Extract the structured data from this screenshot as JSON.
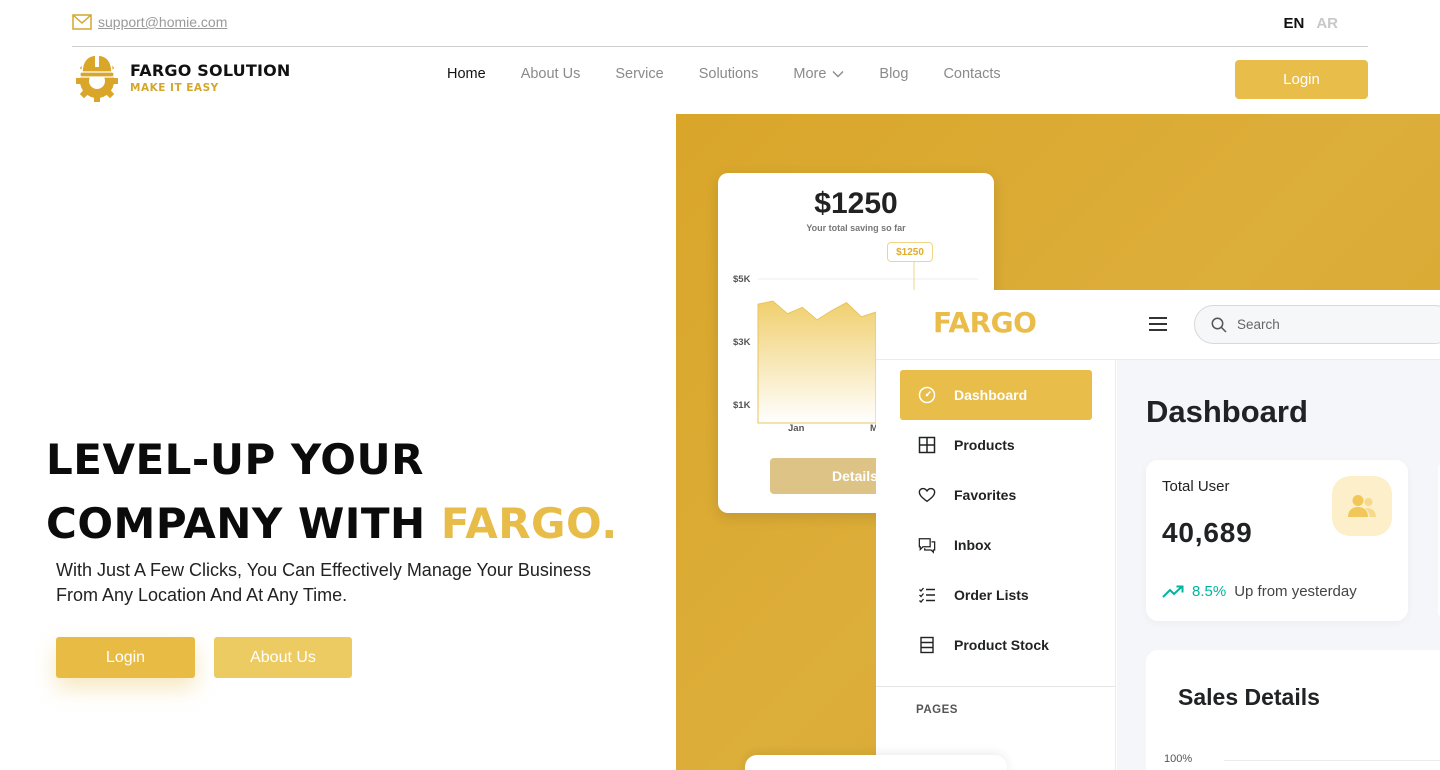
{
  "topbar": {
    "email": "support@homie.com",
    "lang_en": "EN",
    "lang_ar": "AR"
  },
  "brand": {
    "name": "FARGO SOLUTION",
    "tagline": "MAKE IT EASY",
    "logo_icon": "helmet-gear-icon",
    "accent_color": "#E9BD4A"
  },
  "nav": {
    "items": [
      {
        "label": "Home",
        "active": true
      },
      {
        "label": "About Us",
        "active": false
      },
      {
        "label": "Service",
        "active": false
      },
      {
        "label": "Solutions",
        "active": false
      },
      {
        "label": "More",
        "active": false,
        "has_dropdown": true
      },
      {
        "label": "Blog",
        "active": false
      },
      {
        "label": "Contacts",
        "active": false
      }
    ],
    "login_label": "Login"
  },
  "hero": {
    "title_line1": "LEVEL-UP YOUR",
    "title_line2_prefix": "COMPANY WITH ",
    "title_line2_accent": "FARGO.",
    "subtitle": "With Just A Few Clicks, You Can Effectively Manage Your Business From Any Location And At Any Time.",
    "btn_login": "Login",
    "btn_about": "About Us"
  },
  "savings_card": {
    "amount": "$1250",
    "caption": "Your total saving so far",
    "tooltip": "$1250",
    "y_labels": [
      "$5K",
      "$3K",
      "$1K"
    ],
    "x_labels": [
      "Jan",
      "M"
    ],
    "details_label": "Details"
  },
  "chart_data": {
    "type": "area",
    "title": "$1250",
    "subtitle": "Your total saving so far",
    "xlabel": "",
    "ylabel": "",
    "y_ticks": [
      "$1K",
      "$3K",
      "$5K"
    ],
    "x_ticks": [
      "Jan",
      "M"
    ],
    "ylim": [
      1000,
      5000
    ],
    "series": [
      {
        "values": [
          4200,
          4300,
          3900,
          4100,
          3700,
          4000,
          4250,
          3800,
          3950
        ]
      }
    ]
  },
  "dashboard": {
    "logo": "FARGO",
    "search_placeholder": "Search",
    "menu": [
      {
        "label": "Dashboard",
        "icon": "speedometer-icon",
        "active": true
      },
      {
        "label": "Products",
        "icon": "grid-icon",
        "active": false
      },
      {
        "label": "Favorites",
        "icon": "heart-icon",
        "active": false
      },
      {
        "label": "Inbox",
        "icon": "chat-icon",
        "active": false
      },
      {
        "label": "Order Lists",
        "icon": "checklist-icon",
        "active": false
      },
      {
        "label": "Product Stock",
        "icon": "stock-icon",
        "active": false
      }
    ],
    "pages_heading": "PAGES",
    "page_title": "Dashboard",
    "total_user": {
      "label": "Total User",
      "value": "40,689",
      "trend_pct": "8.5%",
      "trend_text": "Up from yesterday"
    },
    "sales": {
      "title": "Sales Details",
      "first_tick": "100%"
    }
  }
}
